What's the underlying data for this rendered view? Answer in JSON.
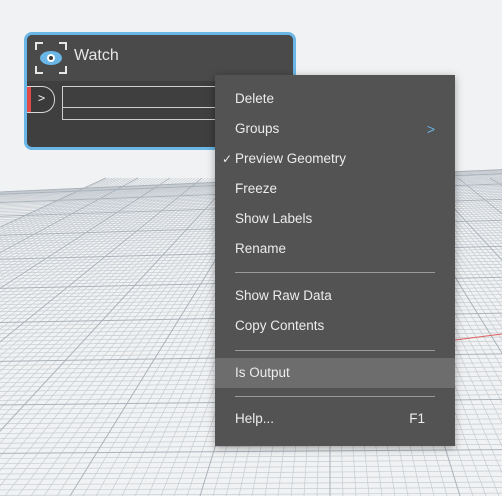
{
  "node": {
    "title": "Watch",
    "input_port": ">"
  },
  "menu": {
    "delete": "Delete",
    "groups": "Groups",
    "groups_chevron": ">",
    "preview_check": "✓",
    "preview_geometry": "Preview Geometry",
    "freeze": "Freeze",
    "show_labels": "Show Labels",
    "rename": "Rename",
    "show_raw_data": "Show Raw Data",
    "copy_contents": "Copy Contents",
    "is_output": "Is Output",
    "help": "Help...",
    "help_shortcut": "F1"
  },
  "colors": {
    "node_border": "#6ab6e6",
    "port_marker": "#e24a4a",
    "menu_bg": "#535353",
    "menu_highlight": "#6d6d6d"
  }
}
